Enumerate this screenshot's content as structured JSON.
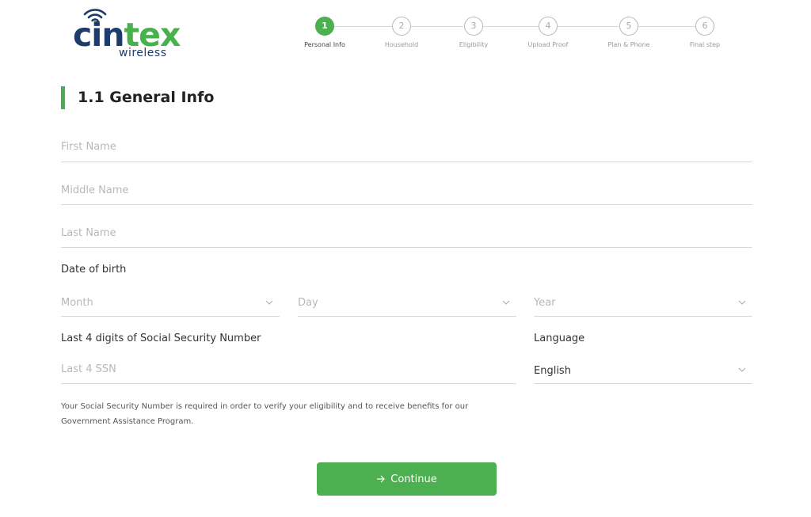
{
  "logo": {
    "brand_part1": "cin",
    "brand_part2": "tex",
    "subtitle": "wireless"
  },
  "stepper": {
    "steps": [
      {
        "number": "1",
        "label": "Personal Info",
        "active": true
      },
      {
        "number": "2",
        "label": "Household"
      },
      {
        "number": "3",
        "label": "Eligibility"
      },
      {
        "number": "4",
        "label": "Upload Proof"
      },
      {
        "number": "5",
        "label": "Plan & Phone"
      },
      {
        "number": "6",
        "label": "Final step"
      }
    ]
  },
  "section": {
    "title": "1.1 General Info"
  },
  "form": {
    "first_name": {
      "placeholder": "First Name"
    },
    "middle_name": {
      "placeholder": "Middle Name"
    },
    "last_name": {
      "placeholder": "Last Name"
    },
    "dob_label": "Date of birth",
    "month": {
      "placeholder": "Month"
    },
    "day": {
      "placeholder": "Day"
    },
    "year": {
      "placeholder": "Year"
    },
    "ssn_label": "Last 4 digits of Social Security Number",
    "ssn": {
      "placeholder": "Last 4 SSN"
    },
    "language_label": "Language",
    "language": {
      "value": "English"
    },
    "ssn_note": "Your Social Security Number is required in order to verify your eligibility and to receive benefits for our Government Assistance Program."
  },
  "actions": {
    "continue_label": "Continue"
  },
  "colors": {
    "accent": "#4caf50",
    "brand_navy": "#1d3c6e",
    "brand_green": "#47b14b"
  }
}
